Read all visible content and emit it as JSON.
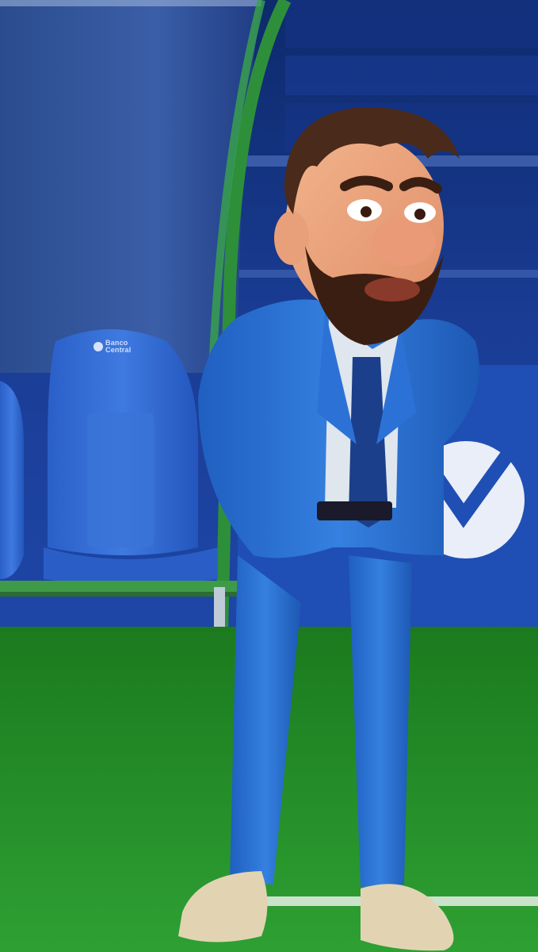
{
  "scene": {
    "seat_logo_line1": "Banco",
    "seat_logo_line2": "Central"
  },
  "colors": {
    "stadium_blue": "#1b3f9a",
    "suit_blue": "#2a6fd0",
    "grass_green": "#1f8a24",
    "bench_green": "#2e7d32"
  }
}
